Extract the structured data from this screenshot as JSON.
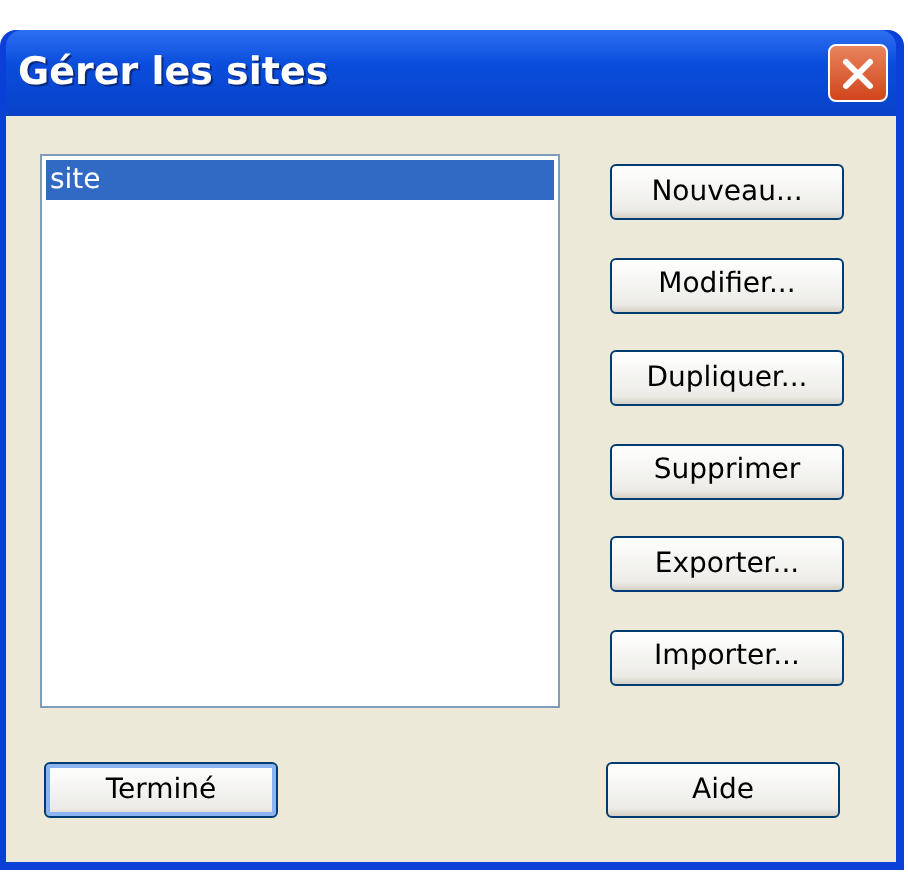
{
  "window": {
    "title": "Gérer les sites"
  },
  "sites": [
    {
      "label": "site",
      "selected": true
    }
  ],
  "side_buttons": [
    "Nouveau...",
    "Modifier...",
    "Dupliquer...",
    "Supprimer",
    "Exporter...",
    "Importer..."
  ],
  "bottom_buttons": [
    {
      "label": "Terminé",
      "default": true
    },
    {
      "label": "Aide",
      "default": false
    }
  ]
}
